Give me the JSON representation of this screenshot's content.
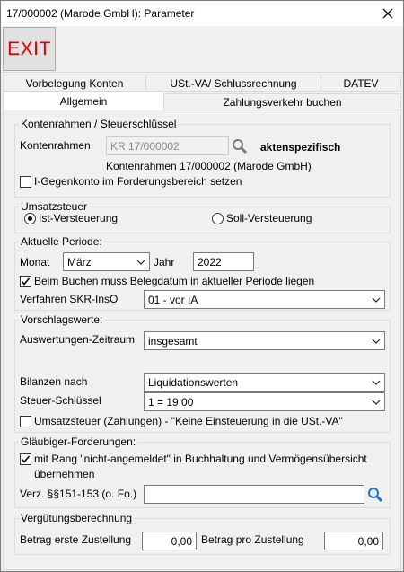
{
  "window": {
    "title": "17/000002 (Marode GmbH): Parameter"
  },
  "toolbar": {
    "exit_label": "EXIT"
  },
  "tabs": {
    "row1": [
      "Vorbelegung Konten",
      "USt.-VA/ Schlussrechnung",
      "DATEV"
    ],
    "row2": [
      "Allgemein",
      "Zahlungsverkehr buchen"
    ],
    "active": "Allgemein"
  },
  "kontenrahmen": {
    "legend": "Kontenrahmen / Steuerschlüssel",
    "label": "Kontenrahmen",
    "value": "KR 17/000002",
    "note": "aktenspezifisch",
    "description": "Kontenrahmen 17/000002 (Marode GmbH)",
    "gegenkonto_label": "I-Gegenkonto im Forderungsbereich setzen",
    "gegenkonto_checked": false
  },
  "umsatzsteuer": {
    "legend": "Umsatzsteuer",
    "ist_label": "Ist-Versteuerung",
    "soll_label": "Soll-Versteuerung",
    "selected": "Ist-Versteuerung"
  },
  "periode": {
    "legend": "Aktuelle Periode:",
    "monat_label": "Monat",
    "monat_value": "März",
    "jahr_label": "Jahr",
    "jahr_value": "2022",
    "belegdatum_label": "Beim Buchen muss Belegdatum in aktueller Periode liegen",
    "belegdatum_checked": true,
    "verfahren_label": "Verfahren SKR-InsO",
    "verfahren_value": "01 - vor IA"
  },
  "vorschlag": {
    "legend": "Vorschlagswerte:",
    "zeitraum_label": "Auswertungen-Zeitraum",
    "zeitraum_value": "insgesamt",
    "bilanzen_label": "Bilanzen nach",
    "bilanzen_value": "Liquidationswerten",
    "steuer_label": "Steuer-Schlüssel",
    "steuer_value": "1 = 19,00",
    "ust_label": "Umsatzsteuer (Zahlungen) - \"Keine Einsteuerung in die USt.-VA\"",
    "ust_checked": false
  },
  "glaeubiger": {
    "legend": "Gläubiger-Forderungen:",
    "rang_label_line1": "mit Rang \"nicht-angemeldet\" in Buchhaltung und Vermögensübersicht",
    "rang_label_line2": "übernehmen",
    "rang_checked": true,
    "verz_label": "Verz. §§151-153 (o. Fo.)",
    "verz_value": ""
  },
  "verguetung": {
    "legend": "Vergütungsberechnung",
    "erste_label": "Betrag erste Zustellung",
    "erste_value": "0,00",
    "pro_label": "Betrag pro Zustellung",
    "pro_value": "0,00"
  }
}
